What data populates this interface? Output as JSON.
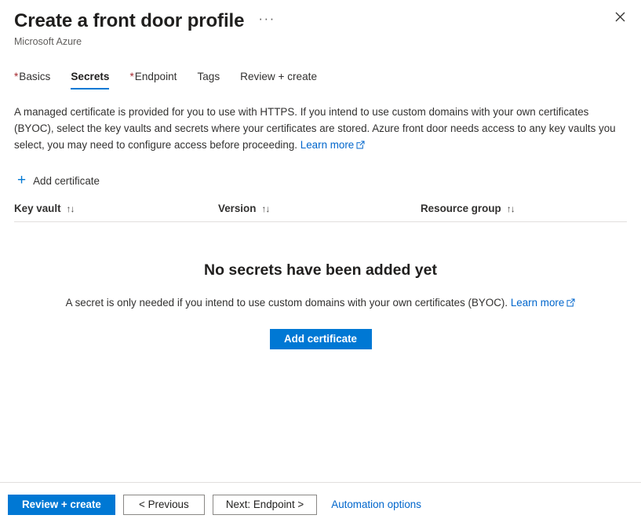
{
  "header": {
    "title": "Create a front door profile",
    "subtitle": "Microsoft Azure",
    "more_menu": "···",
    "close_label": "Close"
  },
  "tabs": [
    {
      "label": "Basics",
      "required": true,
      "active": false
    },
    {
      "label": "Secrets",
      "required": false,
      "active": true
    },
    {
      "label": "Endpoint",
      "required": true,
      "active": false
    },
    {
      "label": "Tags",
      "required": false,
      "active": false
    },
    {
      "label": "Review + create",
      "required": false,
      "active": false
    }
  ],
  "description": {
    "text": "A managed certificate is provided for you to use with HTTPS. If you intend to use custom domains with your own certificates (BYOC), select the key vaults and secrets where your certificates are stored. Azure front door needs access to any key vaults you select, you may need to configure access before proceeding.",
    "link_label": "Learn more"
  },
  "command_bar": {
    "add_certificate_label": "Add certificate",
    "plus_icon": "+"
  },
  "table": {
    "columns": [
      {
        "label": "Key vault",
        "sort_icon": "↑↓"
      },
      {
        "label": "Version",
        "sort_icon": "↑↓"
      },
      {
        "label": "Resource group",
        "sort_icon": "↑↓"
      }
    ],
    "rows": []
  },
  "empty_state": {
    "title": "No secrets have been added yet",
    "subtitle": "A secret is only needed if you intend to use custom domains with your own certificates (BYOC).",
    "link_label": "Learn more",
    "button_label": "Add certificate"
  },
  "footer": {
    "review_create_label": "Review + create",
    "previous_label": "< Previous",
    "next_label": "Next: Endpoint >",
    "automation_label": "Automation options"
  },
  "colors": {
    "accent": "#0078d4",
    "link": "#0066cc",
    "required_asterisk": "#a4262c",
    "text": "#323130",
    "border": "#e1dfdd"
  }
}
